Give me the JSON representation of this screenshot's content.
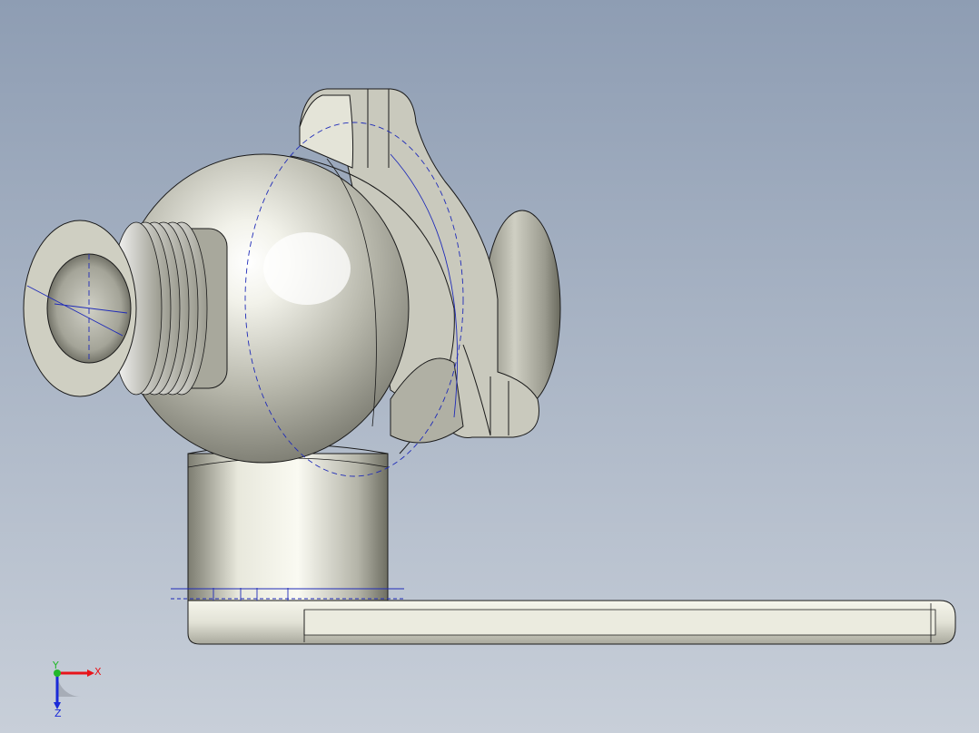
{
  "viewport": {
    "background_top": "#8e9db3",
    "background_bottom": "#c8cfd9"
  },
  "colors": {
    "metal": "#d8d8cc",
    "metal_light": "#ffffff",
    "metal_dark": "#6e6e62",
    "edge": "#1a1a1a",
    "sketch": "#1f2bb8"
  },
  "model": {
    "name_icon": "valve-body-3d-model",
    "parts": [
      "threaded-inlet",
      "spherical-body",
      "side-bonnet",
      "vertical-stem",
      "handle-lever"
    ]
  },
  "triad": {
    "x_label": "X",
    "y_label": "Y",
    "z_label": "Z",
    "x_color": "#e8141a",
    "y_color": "#22b82a",
    "z_color": "#1a2ad8"
  }
}
